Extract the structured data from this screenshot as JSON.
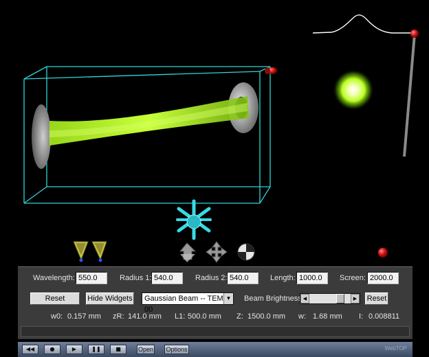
{
  "viewer": {
    "scene_objects": [
      "beam-box",
      "laser-beam",
      "left-mirror",
      "right-mirror",
      "intensity-profile",
      "screen-spot",
      "control-widgets"
    ]
  },
  "params": {
    "wavelength_label": "Wavelength:",
    "wavelength_value": "550.0",
    "radius1_label": "Radius 1:",
    "radius1_value": "540.0",
    "radius2_label": "Radius 2:",
    "radius2_value": "540.0",
    "length_label": "Length:",
    "length_value": "1000.0",
    "screen_label": "Screen:",
    "screen_value": "2000.0"
  },
  "controls": {
    "reset_label": "Reset",
    "hide_widgets_label": "Hide Widgets",
    "beam_type_selected": "Gaussian Beam -- TEM 00",
    "brightness_label": "Beam Brightness:",
    "brightness_level": 0.82,
    "reset2_label": "Reset"
  },
  "readouts": {
    "w0_label": "w0:",
    "w0_value": "0.157 mm",
    "zR_label": "zR:",
    "zR_value": "141.0 mm",
    "L1_label": "L1:",
    "L1_value": "500.0 mm",
    "Z_label": "Z:",
    "Z_value": "1500.0 mm",
    "w_label": "w:",
    "w_value": "1.68 mm",
    "I_label": "I:",
    "I_value": "0.008811"
  },
  "player": {
    "open_label": "Open",
    "options_label": "Options",
    "brand": "WebTOP"
  },
  "colors": {
    "box_edges": "#2fd7d7",
    "beam": "#b5ff1a",
    "widget": "#39d9e6",
    "handle": "#d01818"
  }
}
